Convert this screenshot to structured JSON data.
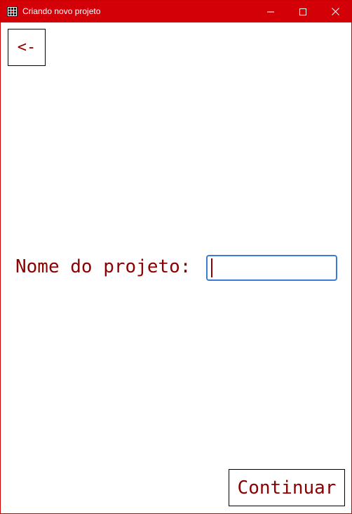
{
  "window": {
    "title": "Criando novo projeto",
    "icon": "app-grid-icon",
    "controls": {
      "minimize_icon": "minimize-icon",
      "maximize_icon": "maximize-icon",
      "close_icon": "close-icon"
    }
  },
  "toolbar": {
    "back_label": "<-"
  },
  "form": {
    "name_label": "Nome do projeto:",
    "name_value": ""
  },
  "footer": {
    "continue_label": "Continuar"
  },
  "colors": {
    "titlebar": "#d40008",
    "text_accent": "#8b0000",
    "input_focus": "#3a7bd5"
  }
}
